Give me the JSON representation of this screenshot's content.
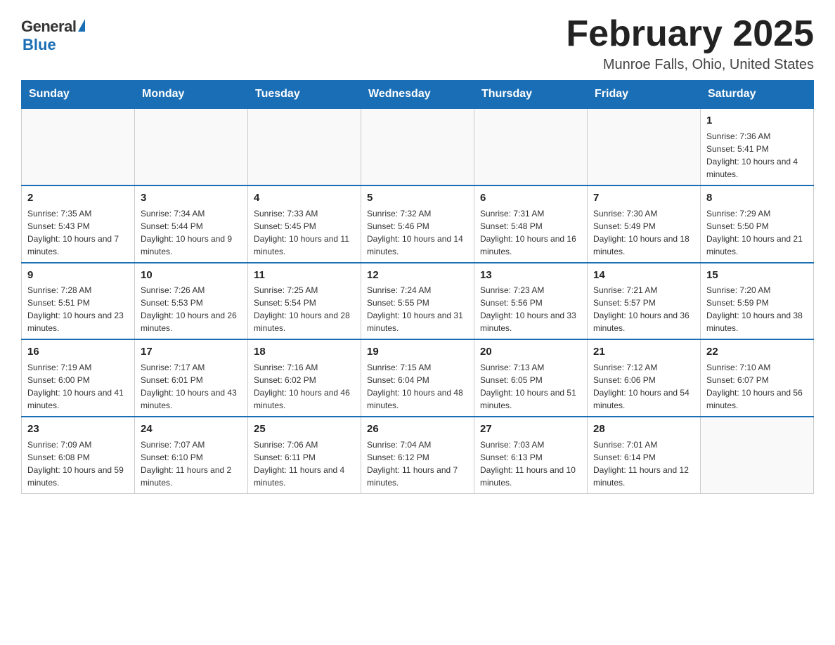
{
  "logo": {
    "general": "General",
    "blue": "Blue"
  },
  "title": "February 2025",
  "location": "Munroe Falls, Ohio, United States",
  "days_of_week": [
    "Sunday",
    "Monday",
    "Tuesday",
    "Wednesday",
    "Thursday",
    "Friday",
    "Saturday"
  ],
  "weeks": [
    [
      {
        "day": "",
        "info": ""
      },
      {
        "day": "",
        "info": ""
      },
      {
        "day": "",
        "info": ""
      },
      {
        "day": "",
        "info": ""
      },
      {
        "day": "",
        "info": ""
      },
      {
        "day": "",
        "info": ""
      },
      {
        "day": "1",
        "info": "Sunrise: 7:36 AM\nSunset: 5:41 PM\nDaylight: 10 hours and 4 minutes."
      }
    ],
    [
      {
        "day": "2",
        "info": "Sunrise: 7:35 AM\nSunset: 5:43 PM\nDaylight: 10 hours and 7 minutes."
      },
      {
        "day": "3",
        "info": "Sunrise: 7:34 AM\nSunset: 5:44 PM\nDaylight: 10 hours and 9 minutes."
      },
      {
        "day": "4",
        "info": "Sunrise: 7:33 AM\nSunset: 5:45 PM\nDaylight: 10 hours and 11 minutes."
      },
      {
        "day": "5",
        "info": "Sunrise: 7:32 AM\nSunset: 5:46 PM\nDaylight: 10 hours and 14 minutes."
      },
      {
        "day": "6",
        "info": "Sunrise: 7:31 AM\nSunset: 5:48 PM\nDaylight: 10 hours and 16 minutes."
      },
      {
        "day": "7",
        "info": "Sunrise: 7:30 AM\nSunset: 5:49 PM\nDaylight: 10 hours and 18 minutes."
      },
      {
        "day": "8",
        "info": "Sunrise: 7:29 AM\nSunset: 5:50 PM\nDaylight: 10 hours and 21 minutes."
      }
    ],
    [
      {
        "day": "9",
        "info": "Sunrise: 7:28 AM\nSunset: 5:51 PM\nDaylight: 10 hours and 23 minutes."
      },
      {
        "day": "10",
        "info": "Sunrise: 7:26 AM\nSunset: 5:53 PM\nDaylight: 10 hours and 26 minutes."
      },
      {
        "day": "11",
        "info": "Sunrise: 7:25 AM\nSunset: 5:54 PM\nDaylight: 10 hours and 28 minutes."
      },
      {
        "day": "12",
        "info": "Sunrise: 7:24 AM\nSunset: 5:55 PM\nDaylight: 10 hours and 31 minutes."
      },
      {
        "day": "13",
        "info": "Sunrise: 7:23 AM\nSunset: 5:56 PM\nDaylight: 10 hours and 33 minutes."
      },
      {
        "day": "14",
        "info": "Sunrise: 7:21 AM\nSunset: 5:57 PM\nDaylight: 10 hours and 36 minutes."
      },
      {
        "day": "15",
        "info": "Sunrise: 7:20 AM\nSunset: 5:59 PM\nDaylight: 10 hours and 38 minutes."
      }
    ],
    [
      {
        "day": "16",
        "info": "Sunrise: 7:19 AM\nSunset: 6:00 PM\nDaylight: 10 hours and 41 minutes."
      },
      {
        "day": "17",
        "info": "Sunrise: 7:17 AM\nSunset: 6:01 PM\nDaylight: 10 hours and 43 minutes."
      },
      {
        "day": "18",
        "info": "Sunrise: 7:16 AM\nSunset: 6:02 PM\nDaylight: 10 hours and 46 minutes."
      },
      {
        "day": "19",
        "info": "Sunrise: 7:15 AM\nSunset: 6:04 PM\nDaylight: 10 hours and 48 minutes."
      },
      {
        "day": "20",
        "info": "Sunrise: 7:13 AM\nSunset: 6:05 PM\nDaylight: 10 hours and 51 minutes."
      },
      {
        "day": "21",
        "info": "Sunrise: 7:12 AM\nSunset: 6:06 PM\nDaylight: 10 hours and 54 minutes."
      },
      {
        "day": "22",
        "info": "Sunrise: 7:10 AM\nSunset: 6:07 PM\nDaylight: 10 hours and 56 minutes."
      }
    ],
    [
      {
        "day": "23",
        "info": "Sunrise: 7:09 AM\nSunset: 6:08 PM\nDaylight: 10 hours and 59 minutes."
      },
      {
        "day": "24",
        "info": "Sunrise: 7:07 AM\nSunset: 6:10 PM\nDaylight: 11 hours and 2 minutes."
      },
      {
        "day": "25",
        "info": "Sunrise: 7:06 AM\nSunset: 6:11 PM\nDaylight: 11 hours and 4 minutes."
      },
      {
        "day": "26",
        "info": "Sunrise: 7:04 AM\nSunset: 6:12 PM\nDaylight: 11 hours and 7 minutes."
      },
      {
        "day": "27",
        "info": "Sunrise: 7:03 AM\nSunset: 6:13 PM\nDaylight: 11 hours and 10 minutes."
      },
      {
        "day": "28",
        "info": "Sunrise: 7:01 AM\nSunset: 6:14 PM\nDaylight: 11 hours and 12 minutes."
      },
      {
        "day": "",
        "info": ""
      }
    ]
  ]
}
